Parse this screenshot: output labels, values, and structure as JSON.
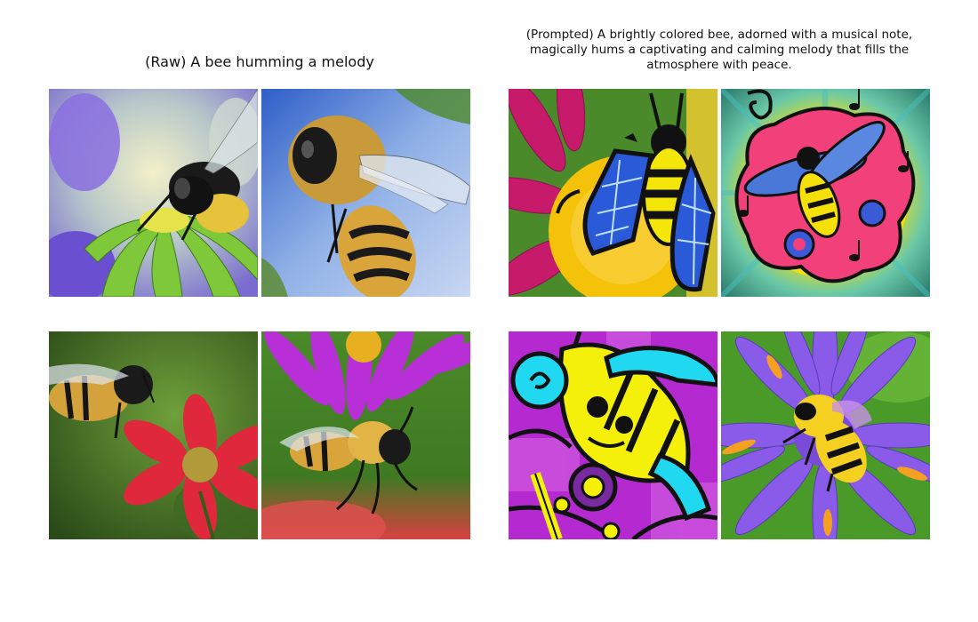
{
  "panels": {
    "raw": {
      "title": "(Raw) A bee humming a melody",
      "images": [
        {
          "depicts": "bumblebee on a green and purple flower"
        },
        {
          "depicts": "fuzzy honeybee in flight against blue background"
        },
        {
          "depicts": "bee flying toward a red flower"
        },
        {
          "depicts": "bee beneath a purple flower"
        }
      ]
    },
    "prompted": {
      "title": "(Prompted) A brightly colored bee, adorned with a musical note, magically hums a captivating and calming melody that fills the atmosphere with peace.",
      "images": [
        {
          "depicts": "cartoon bee with stained-glass blue wings on yellow flower"
        },
        {
          "depicts": "illustrated bee on pink flower with music notes"
        },
        {
          "depicts": "abstract yellow and cyan bee on purple background"
        },
        {
          "depicts": "fuzzy bee on purple aster flower"
        }
      ]
    }
  },
  "colors": {
    "background": "#ffffff",
    "text": "#111111"
  }
}
